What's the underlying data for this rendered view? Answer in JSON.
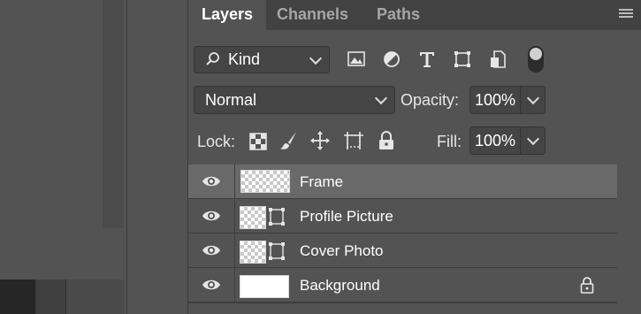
{
  "tabs": [
    {
      "label": "Layers",
      "active": true
    },
    {
      "label": "Channels",
      "active": false
    },
    {
      "label": "Paths",
      "active": false
    }
  ],
  "filter": {
    "kind_label": "Kind",
    "icons": [
      "search-icon",
      "pixel-layer-filter-icon",
      "adjustment-layer-filter-icon",
      "type-layer-filter-icon",
      "shape-layer-filter-icon",
      "smart-object-filter-icon"
    ],
    "toggle_on": true
  },
  "blend": {
    "mode": "Normal",
    "opacity_label": "Opacity:",
    "opacity_value": "100%"
  },
  "lock": {
    "label": "Lock:",
    "icons": [
      "lock-transparent-pixels-icon",
      "lock-image-pixels-icon",
      "lock-position-icon",
      "lock-artboard-icon",
      "lock-all-icon"
    ],
    "fill_label": "Fill:",
    "fill_value": "100%"
  },
  "layers": [
    {
      "name": "Frame",
      "selected": true,
      "visible": true,
      "thumb": "frame",
      "locked": false
    },
    {
      "name": "Profile Picture",
      "selected": false,
      "visible": true,
      "thumb": "transparent-with-mask",
      "locked": false
    },
    {
      "name": "Cover Photo",
      "selected": false,
      "visible": true,
      "thumb": "transparent-with-mask",
      "locked": false
    },
    {
      "name": "Background",
      "selected": false,
      "visible": true,
      "thumb": "white",
      "locked": true
    }
  ],
  "colors": {
    "panel_bg": "#535353",
    "tabbar_bg": "#424242",
    "selected_row": "#696969",
    "field_bg": "#454545"
  }
}
